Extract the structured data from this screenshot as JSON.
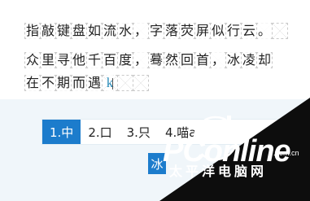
{
  "editor": {
    "lines": [
      {
        "cells": [
          "指",
          "敲",
          "键",
          "盘",
          "如",
          "流",
          "水",
          "，",
          "字",
          "落",
          "荧",
          "屏",
          "似",
          "行",
          "云",
          "。",
          ""
        ]
      },
      {
        "cells": [
          "众",
          "里",
          "寻",
          "他",
          "千",
          "百",
          "度",
          "，",
          "蓦",
          "然",
          "回",
          "首",
          "，",
          "冰",
          "凌",
          "却"
        ]
      },
      {
        "cells": [
          "在",
          "不",
          "期",
          "而",
          "遇",
          "k",
          "",
          ""
        ]
      }
    ],
    "caret_char": "k"
  },
  "ime": {
    "candidates": [
      {
        "label": "1.中"
      },
      {
        "label": "2.口"
      },
      {
        "label": "3.只"
      },
      {
        "label": "4.喵a"
      }
    ],
    "selected_index": 0,
    "composition": "冰"
  },
  "watermark": {
    "brand": "PConline",
    "domain": ".com.cn",
    "cn": "太平洋电脑网",
    "colors": {
      "dark": "#0d0d0d",
      "white": "#ffffff"
    }
  },
  "colors": {
    "accent": "#1c7ccc",
    "background": "#f0f6fa",
    "grid": "#c9c9c9",
    "caret_text": "#2a8bb8"
  }
}
